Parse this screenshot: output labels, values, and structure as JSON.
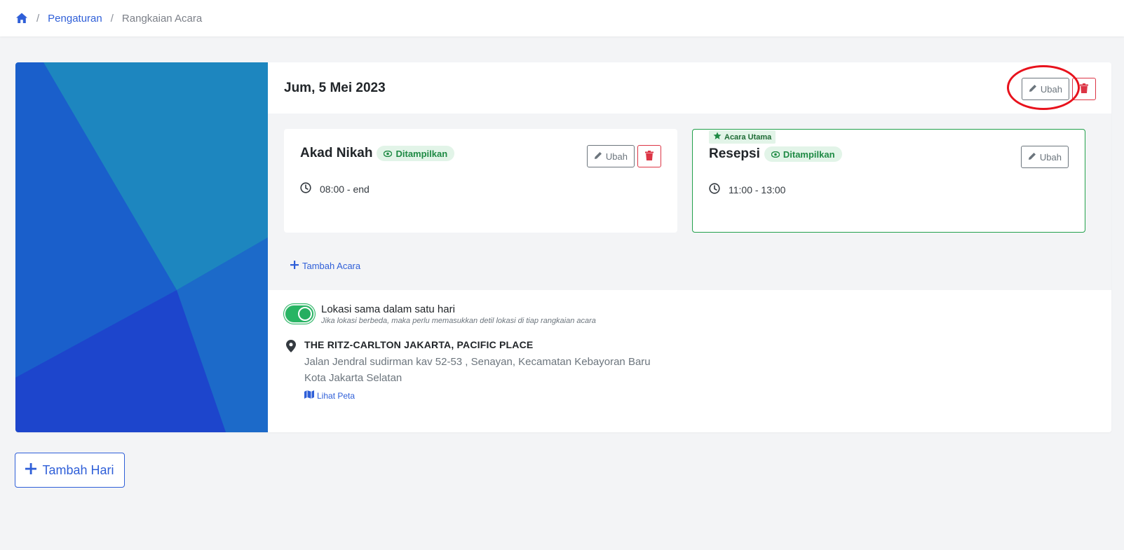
{
  "breadcrumb": {
    "home_icon": "home-icon",
    "items": [
      "Pengaturan",
      "Rangkaian Acara"
    ]
  },
  "day": {
    "title": "Jum, 5 Mei 2023",
    "edit_label": "Ubah",
    "delete_icon": "trash-icon"
  },
  "events": [
    {
      "name": "Akad Nikah",
      "status": "Ditampilkan",
      "time": "08:00 - end",
      "edit_label": "Ubah",
      "main": false
    },
    {
      "name": "Resepsi",
      "status": "Ditampilkan",
      "time": "11:00 - 13:00",
      "edit_label": "Ubah",
      "main": true,
      "main_label": "Acara Utama"
    }
  ],
  "add_event_label": "Tambah Acara",
  "location": {
    "toggle_on": true,
    "toggle_label": "Lokasi sama dalam satu hari",
    "toggle_help": "Jika lokasi berbeda, maka perlu memasukkan detil lokasi di tiap rangkaian acara",
    "venue_name": "THE RITZ-CARLTON JAKARTA, PACIFIC PLACE",
    "address_line1": "Jalan Jendral sudirman kav 52-53 , Senayan, Kecamatan Kebayoran Baru",
    "address_line2": "Kota Jakarta Selatan",
    "map_link": "Lihat Peta"
  },
  "add_day_label": "Tambah Hari",
  "colors": {
    "accent": "#2f5fd8",
    "success": "#28b463",
    "danger": "#dc3545",
    "highlight": "#e8121c"
  }
}
